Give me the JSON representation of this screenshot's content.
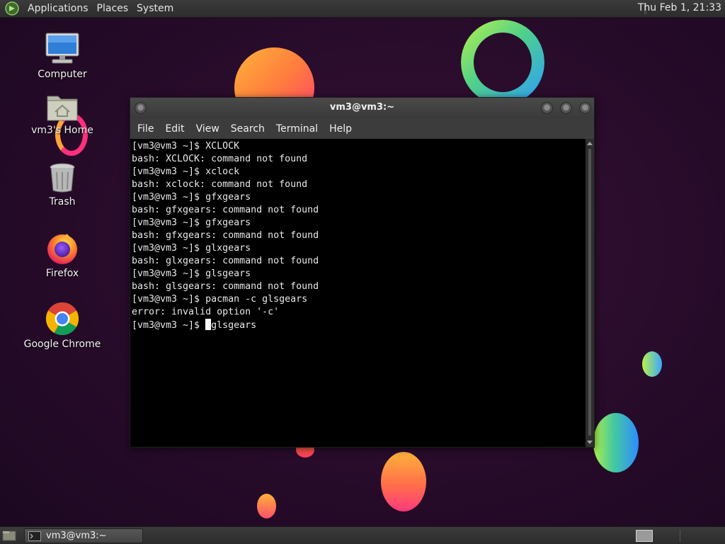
{
  "top_panel": {
    "menus": [
      "Applications",
      "Places",
      "System"
    ],
    "clock": "Thu Feb  1, 21:33"
  },
  "desktop_icons": [
    {
      "label": "Computer",
      "icon": "computer-icon"
    },
    {
      "label": "vm3's Home",
      "icon": "home-folder-icon"
    },
    {
      "label": "Trash",
      "icon": "trash-icon"
    },
    {
      "label": "Firefox",
      "icon": "firefox-icon"
    },
    {
      "label": "Google Chrome",
      "icon": "chrome-icon"
    }
  ],
  "terminal": {
    "title": "vm3@vm3:~",
    "menu": [
      "File",
      "Edit",
      "View",
      "Search",
      "Terminal",
      "Help"
    ],
    "lines": [
      "[vm3@vm3 ~]$ XCLOCK",
      "bash: XCLOCK: command not found",
      "[vm3@vm3 ~]$ xclock",
      "bash: xclock: command not found",
      "[vm3@vm3 ~]$ gfxgears",
      "bash: gfxgears: command not found",
      "[vm3@vm3 ~]$ gfxgears",
      "bash: gfxgears: command not found",
      "[vm3@vm3 ~]$ glxgears",
      "bash: glxgears: command not found",
      "[vm3@vm3 ~]$ glsgears",
      "bash: glsgears: command not found",
      "[vm3@vm3 ~]$ pacman -c glsgears",
      "error: invalid option '-c'"
    ],
    "prompt": "[vm3@vm3 ~]$ ",
    "input_after_cursor": "glsgears"
  },
  "taskbar": {
    "task_label": "vm3@vm3:~"
  }
}
